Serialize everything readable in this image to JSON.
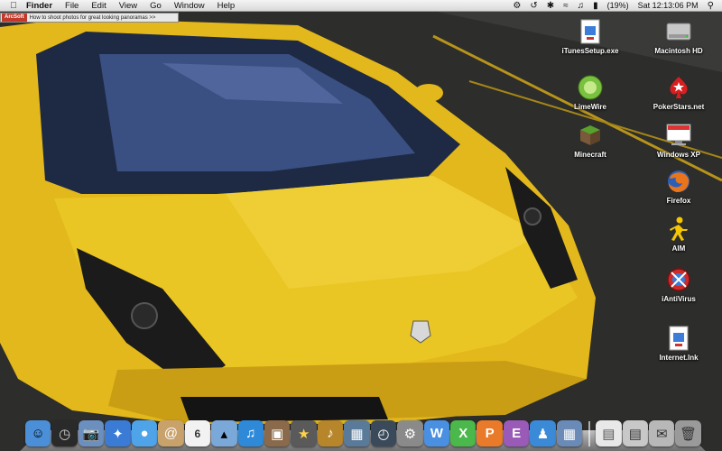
{
  "menubar": {
    "apple_icon": "apple-icon",
    "app_name": "Finder",
    "menus": [
      "File",
      "Edit",
      "View",
      "Go",
      "Window",
      "Help"
    ],
    "battery": "(19%)",
    "clock": "Sat 12:13:06 PM"
  },
  "arcsoft": {
    "logo": "ArcSoft",
    "text": "How to shoot photos for great looking panoramas >>"
  },
  "desktop_icons": [
    {
      "label": "iTunesSetup.exe",
      "icon": "installer-file-icon"
    },
    {
      "label": "Macintosh HD",
      "icon": "hard-drive-icon"
    },
    {
      "label": "LimeWire",
      "icon": "limewire-icon"
    },
    {
      "label": "PokerStars.net",
      "icon": "pokerstars-icon"
    },
    {
      "label": "Minecraft",
      "icon": "minecraft-icon"
    },
    {
      "label": "Windows XP",
      "icon": "parallels-windows-icon"
    },
    {
      "label": "Firefox",
      "icon": "firefox-icon"
    },
    {
      "label": "AIM",
      "icon": "aim-icon"
    },
    {
      "label": "iAntiVirus",
      "icon": "iantivirus-icon"
    },
    {
      "label": "Internet.lnk",
      "icon": "shortcut-file-icon"
    }
  ],
  "dock": {
    "calendar_day": "6",
    "items": [
      {
        "name": "finder",
        "color": "#4a8fd8"
      },
      {
        "name": "dashboard",
        "color": "#333333"
      },
      {
        "name": "preview",
        "color": "#6b8fbf"
      },
      {
        "name": "safari",
        "color": "#3a7bd5"
      },
      {
        "name": "ichat",
        "color": "#4fa3e8"
      },
      {
        "name": "address-book",
        "color": "#c8a26a"
      },
      {
        "name": "ical",
        "color": "#f2f2f2"
      },
      {
        "name": "iphoto",
        "color": "#7aa8d8"
      },
      {
        "name": "itunes",
        "color": "#2e8ad8"
      },
      {
        "name": "image-capture",
        "color": "#8a6a4a"
      },
      {
        "name": "imovie",
        "color": "#5a5a5a"
      },
      {
        "name": "garageband",
        "color": "#b8862a"
      },
      {
        "name": "spaces",
        "color": "#5a7a9a"
      },
      {
        "name": "time-machine",
        "color": "#3a4a5a"
      },
      {
        "name": "system-preferences",
        "color": "#8a8a8a"
      },
      {
        "name": "word",
        "color": "#4a90e2"
      },
      {
        "name": "excel",
        "color": "#4ab84a"
      },
      {
        "name": "powerpoint",
        "color": "#e87a2a"
      },
      {
        "name": "entourage",
        "color": "#9a5ab8"
      },
      {
        "name": "messenger",
        "color": "#3a8ad8"
      },
      {
        "name": "applications-stack",
        "color": "#6a8ab8"
      },
      {
        "name": "documents-stack",
        "color": "#e8e8e8"
      },
      {
        "name": "downloads-stack",
        "color": "#c8c8c8"
      },
      {
        "name": "mail-stack",
        "color": "#b8b8b8"
      },
      {
        "name": "trash",
        "color": "#9a9a9a"
      }
    ]
  }
}
